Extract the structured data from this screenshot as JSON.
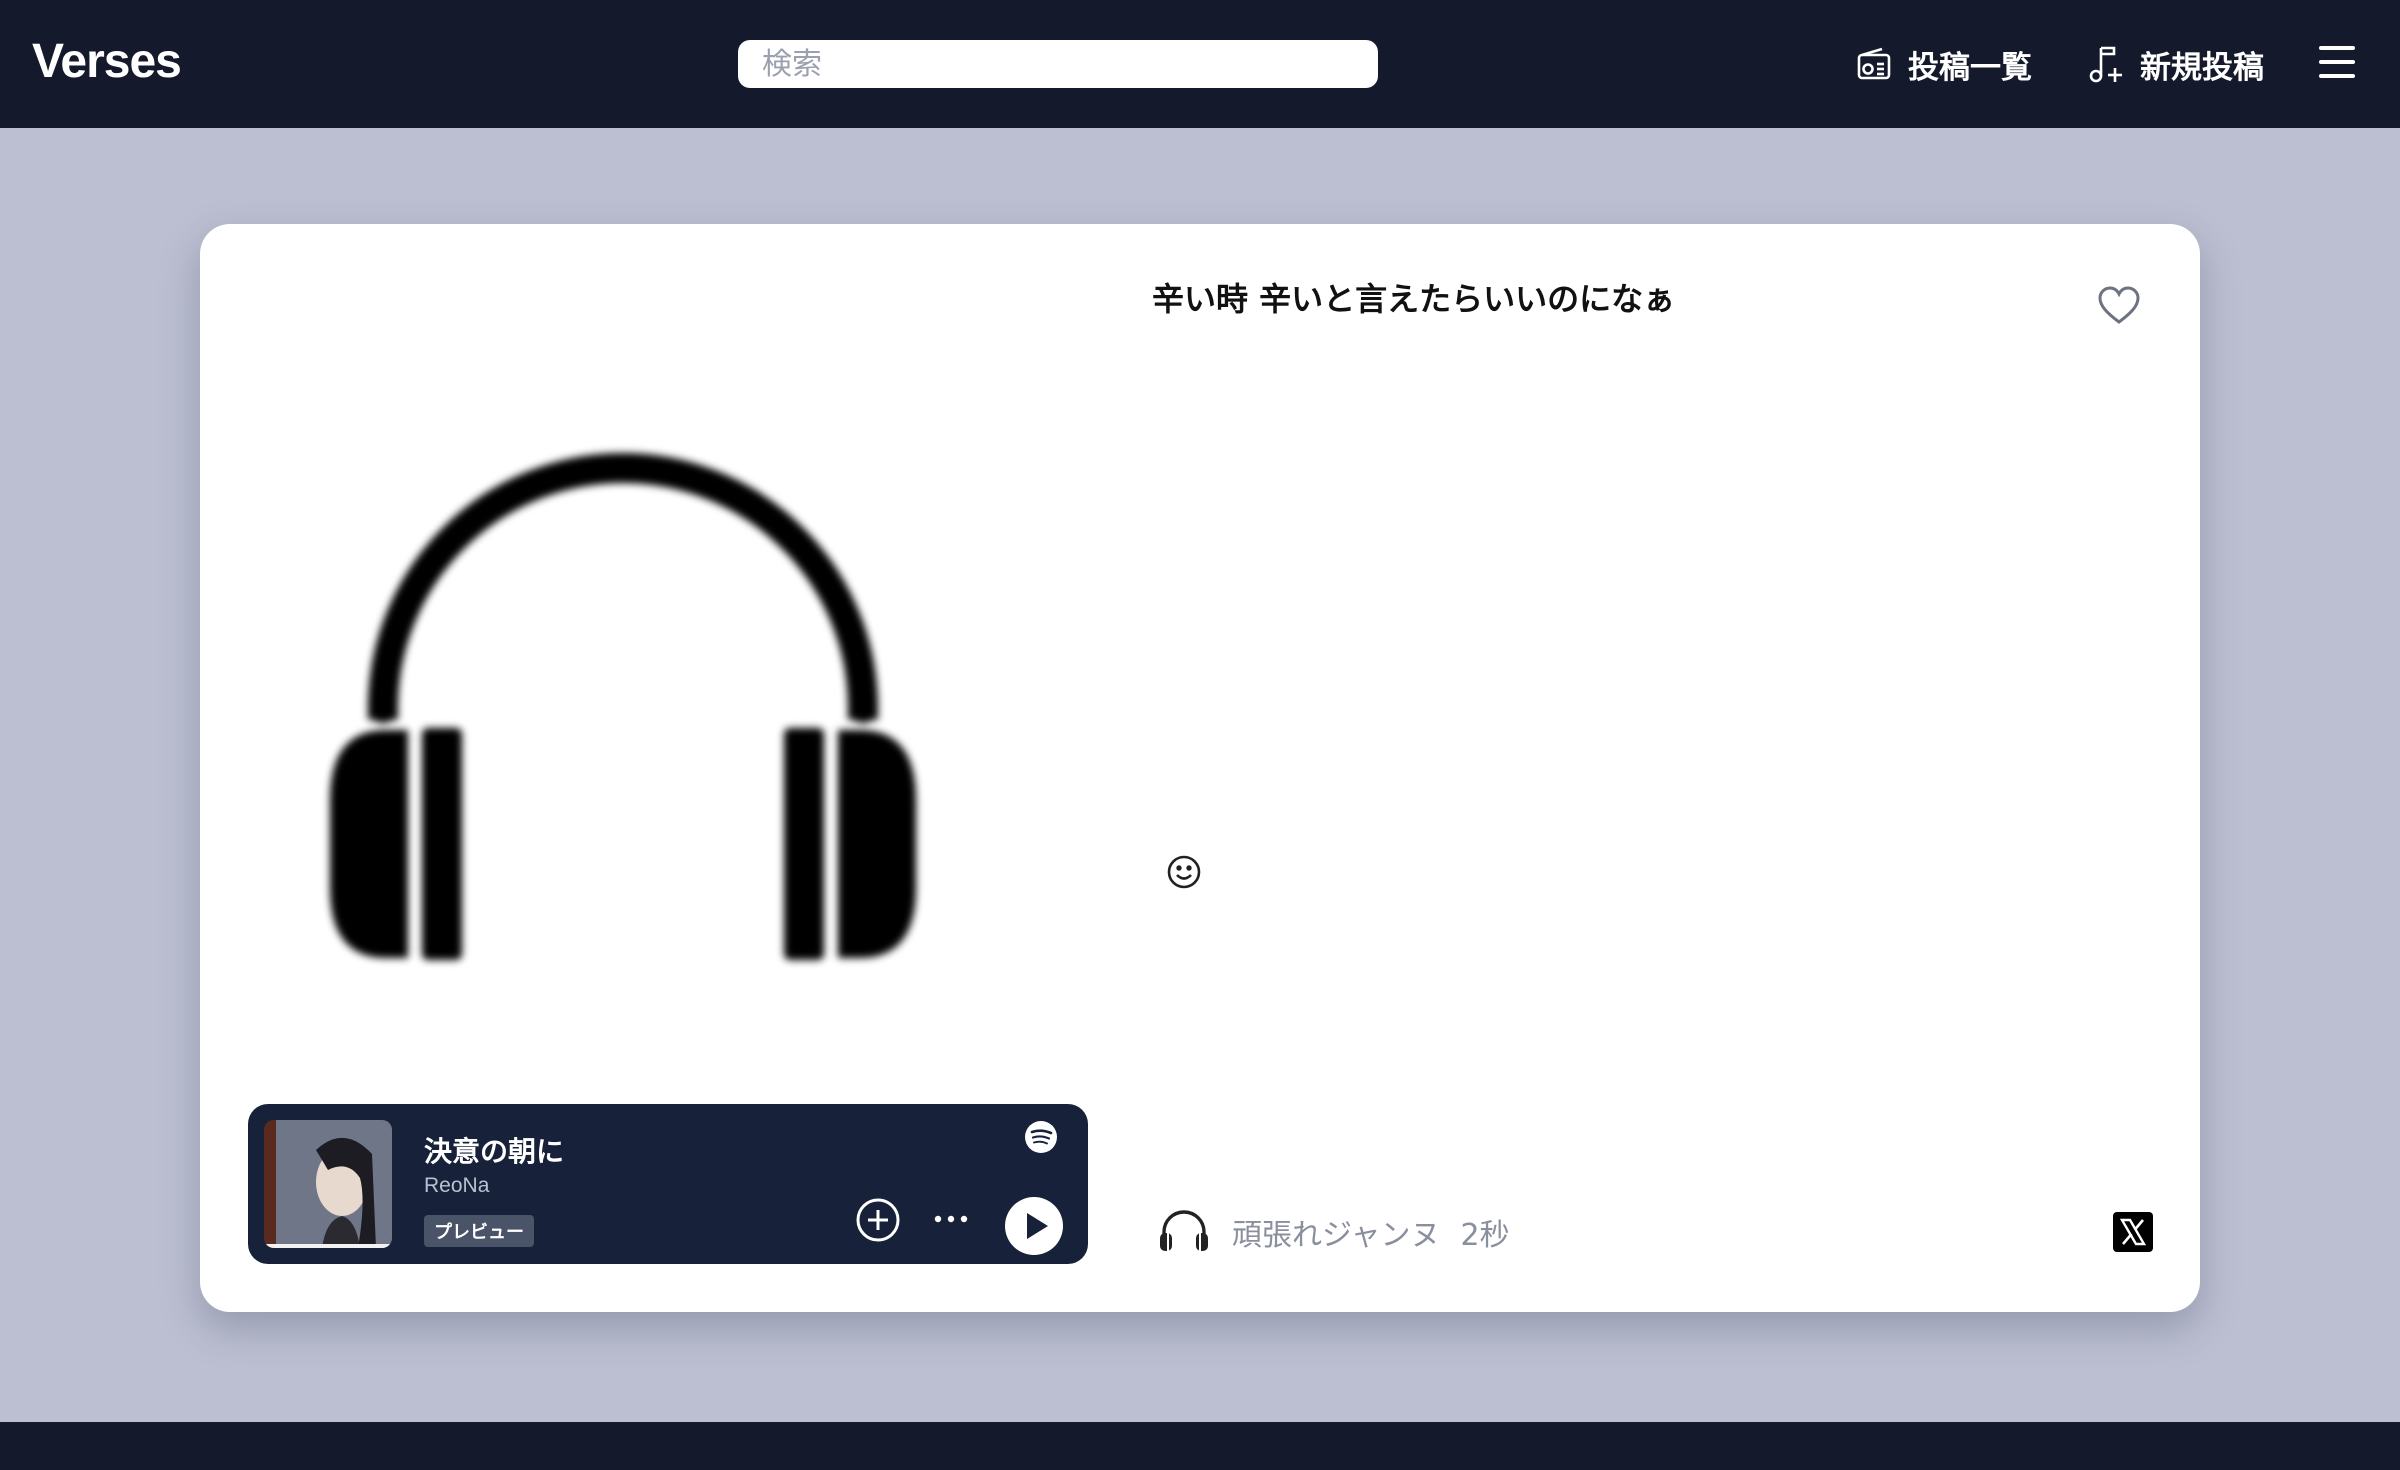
{
  "app": {
    "title": "Verses"
  },
  "search": {
    "placeholder": "検索"
  },
  "nav": {
    "posts_label": "投稿一覧",
    "new_post_label": "新規投稿"
  },
  "post": {
    "lyric": "辛い時 辛いと言えたらいいのになぁ",
    "username": "頑張れジャンヌ",
    "time_ago": "2秒"
  },
  "player": {
    "track_title": "決意の朝に",
    "artist": "ReoNa",
    "badge": "プレビュー"
  },
  "colors": {
    "topbar_bg": "#141a2b",
    "page_bg": "#bbbfd1",
    "player_bg": "#17213a",
    "muted_text": "#8a8f9e"
  },
  "icons": {
    "posts": "radio-icon",
    "new_post": "music-note-plus-icon",
    "menu": "hamburger-menu-icon",
    "like": "heart-outline-icon",
    "emoji": "smiley-icon",
    "listener": "headphones-icon",
    "share": "x-logo-icon",
    "spotify": "spotify-icon",
    "add": "plus-circle-icon",
    "more": "ellipsis-icon",
    "play": "play-icon"
  }
}
